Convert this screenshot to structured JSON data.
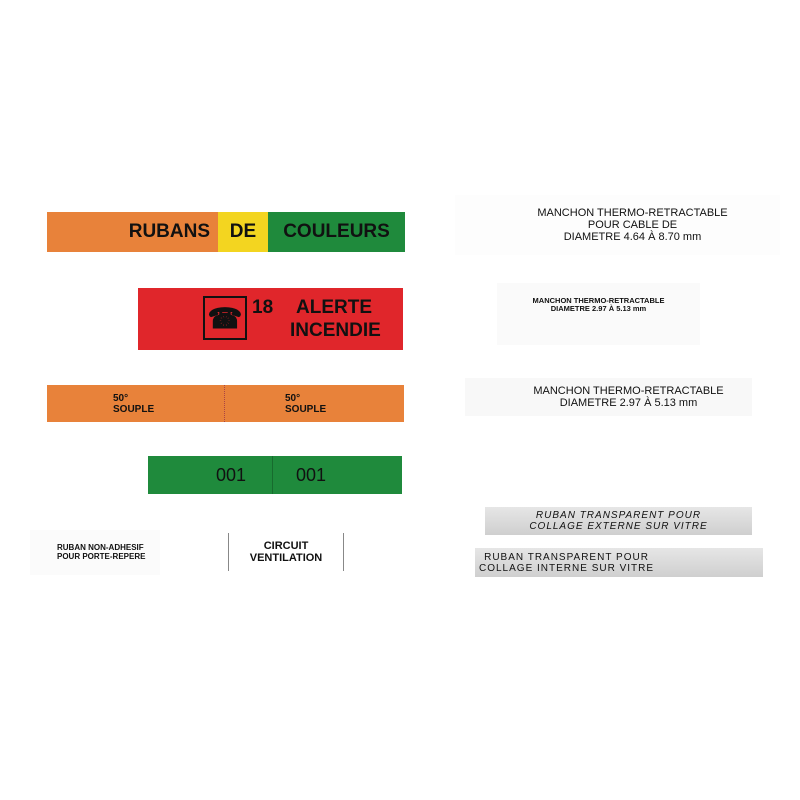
{
  "colors": {
    "orange": "#e8823a",
    "yellow": "#f3d520",
    "green": "#1f8a3c",
    "red": "#e0262b",
    "silver": "#d8d8d8"
  },
  "labels": {
    "rubans": "RUBANS",
    "de": "DE",
    "couleurs": "COULEURS",
    "alerte_number": "18",
    "alerte_line1": "ALERTE",
    "alerte_line2": "INCENDIE",
    "alerte_icon": "fire-phone-icon",
    "souple1": "50°\nSOUPLE",
    "souple2": "50°\nSOUPLE",
    "num1": "001",
    "num2": "001",
    "non_adhesif": "RUBAN NON-ADHESIF\nPOUR PORTE-REPERE",
    "circuit": "CIRCUIT\nVENTILATION",
    "manchon1": "MANCHON THERMO-RETRACTABLE\nPOUR CABLE DE\nDIAMETRE 4.64 À 8.70 mm",
    "manchon2": "MANCHON THERMO-RETRACTABLE\nDIAMETRE 2.97 À 5.13 mm",
    "manchon3": "MANCHON THERMO-RETRACTABLE\nDIAMETRE 2.97 À 5.13 mm",
    "ruban_ext": "RUBAN TRANSPARENT POUR\nCOLLAGE EXTERNE SUR VITRE",
    "ruban_int": "RUBAN TRANSPARENT POUR\nCOLLAGE INTERNE SUR VITRE"
  }
}
